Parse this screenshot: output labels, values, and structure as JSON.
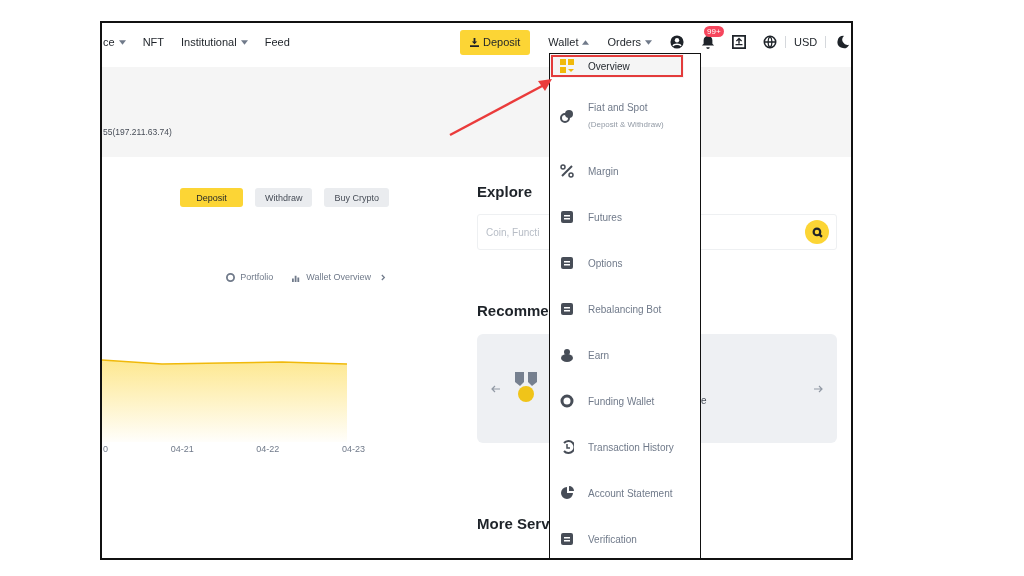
{
  "nav": {
    "items": [
      {
        "label": "ce",
        "dropdown": true
      },
      {
        "label": "NFT",
        "dropdown": false
      },
      {
        "label": "Institutional",
        "dropdown": true
      },
      {
        "label": "Feed",
        "dropdown": false
      }
    ],
    "deposit_button": "Deposit",
    "menus": [
      {
        "label": "Wallet",
        "expanded": true
      },
      {
        "label": "Orders",
        "expanded": false
      }
    ],
    "notification_badge": "99+",
    "currency": "USD"
  },
  "login_info": "55(197.211.63.74)",
  "actions": [
    {
      "label": "Deposit",
      "primary": true
    },
    {
      "label": "Withdraw",
      "primary": false
    },
    {
      "label": "Buy Crypto",
      "primary": false
    }
  ],
  "links": [
    "Portfolio",
    "Wallet Overview"
  ],
  "chart_axis_labels": [
    "0",
    "04-21",
    "04-22",
    "04-23"
  ],
  "explore": {
    "title": "Explore",
    "search": {
      "placeholder": "Coin, Functi"
    }
  },
  "recommend": {
    "title": "Recomme",
    "card_text": "e"
  },
  "more_services": {
    "title": "More Serv"
  },
  "wallet_menu": [
    {
      "label": "Overview",
      "selected": true
    },
    {
      "label": "Fiat and Spot",
      "subtitle": "(Deposit & Withdraw)",
      "selected": false
    },
    {
      "label": "Margin",
      "selected": false
    },
    {
      "label": "Futures",
      "selected": false
    },
    {
      "label": "Options",
      "selected": false
    },
    {
      "label": "Rebalancing Bot",
      "selected": false
    },
    {
      "label": "Earn",
      "selected": false
    },
    {
      "label": "Funding Wallet",
      "selected": false
    },
    {
      "label": "Transaction History",
      "selected": false
    },
    {
      "label": "Account Statement",
      "selected": false
    },
    {
      "label": "Verification",
      "selected": false
    }
  ]
}
